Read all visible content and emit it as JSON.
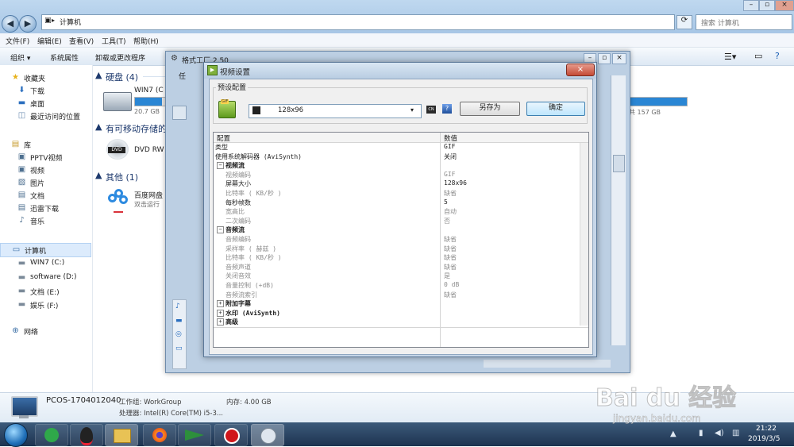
{
  "explorer": {
    "address": "计算机",
    "search_placeholder": "搜索 计算机",
    "menu": [
      "文件(F)",
      "编辑(E)",
      "查看(V)",
      "工具(T)",
      "帮助(H)"
    ],
    "commands": [
      "组织 ▾",
      "系统属性",
      "卸载或更改程序"
    ],
    "nav": {
      "favorites": "收藏夹",
      "downloads": "下载",
      "desktop": "桌面",
      "recent": "最近访问的位置",
      "libraries": "库",
      "pptv": "PPTV视频",
      "videos": "视频",
      "pictures": "图片",
      "documents": "文档",
      "xunlei": "迅雷下载",
      "music": "音乐",
      "computer": "计算机",
      "drive_c": "WIN7 (C:)",
      "drive_d": "software (D:)",
      "drive_e": "文档 (E:)",
      "drive_f": "娱乐 (F:)",
      "network": "网络"
    },
    "groups": {
      "hdd": "硬盘 (4)",
      "removable": "有可移动存储的",
      "other": "其他 (1)"
    },
    "drives": {
      "win7_label": "WIN7 (C",
      "win7_free": "20.7 GB",
      "right_free": "共 157 GB",
      "dvd_label": "DVD RW",
      "baidu_label": "百度网盘",
      "baidu_sub": "双击运行"
    },
    "details": {
      "pc_name": "PCOS-1704012040",
      "workgroup": "工作组: WorkGroup",
      "memory": "内存: 4.00 GB",
      "cpu": "处理器: Intel(R) Core(TM) i5-3..."
    }
  },
  "taskbar": {
    "time": "21:22",
    "date": "2019/3/5"
  },
  "format_window": {
    "title": "格式工厂 2.50",
    "partial_label": "任"
  },
  "dialog": {
    "title": "视频设置",
    "preset_legend": "预设配置",
    "preset_value": "128x96",
    "saveas_label": "另存为",
    "ok_label": "确定",
    "col_config": "配置",
    "col_value": "数值",
    "rows": [
      {
        "c1": "类型",
        "c2": "GIF",
        "level": 0,
        "style": "normal"
      },
      {
        "c1": "使用系统解码器 (AviSynth)",
        "c2": "关闭",
        "level": 0,
        "style": "normal"
      },
      {
        "c1": "视频流",
        "c2": "",
        "level": 0,
        "style": "group-open"
      },
      {
        "c1": "视频编码",
        "c2": "GIF",
        "level": 1,
        "style": "dim"
      },
      {
        "c1": "屏幕大小",
        "c2": "128x96",
        "level": 1,
        "style": "normal"
      },
      {
        "c1": "比特率 ( KB/秒 )",
        "c2": "缺省",
        "level": 1,
        "style": "dim"
      },
      {
        "c1": "每秒帧数",
        "c2": "5",
        "level": 1,
        "style": "normal"
      },
      {
        "c1": "宽高比",
        "c2": "自动",
        "level": 1,
        "style": "dim"
      },
      {
        "c1": "二次编码",
        "c2": "否",
        "level": 1,
        "style": "dim"
      },
      {
        "c1": "音频流",
        "c2": "",
        "level": 0,
        "style": "group-open"
      },
      {
        "c1": "音频编码",
        "c2": "缺省",
        "level": 1,
        "style": "dim"
      },
      {
        "c1": "采样率 ( 赫兹 )",
        "c2": "缺省",
        "level": 1,
        "style": "dim"
      },
      {
        "c1": "比特率 ( KB/秒 )",
        "c2": "缺省",
        "level": 1,
        "style": "dim"
      },
      {
        "c1": "音频声道",
        "c2": "缺省",
        "level": 1,
        "style": "dim"
      },
      {
        "c1": "关闭音效",
        "c2": "是",
        "level": 1,
        "style": "dim"
      },
      {
        "c1": "音量控制 (+dB)",
        "c2": "0 dB",
        "level": 1,
        "style": "dim"
      },
      {
        "c1": "音频流索引",
        "c2": "缺省",
        "level": 1,
        "style": "dim"
      },
      {
        "c1": "附加字幕",
        "c2": "",
        "level": 0,
        "style": "group-closed"
      },
      {
        "c1": "水印 (AviSynth)",
        "c2": "",
        "level": 0,
        "style": "group-closed"
      },
      {
        "c1": "高级",
        "c2": "",
        "level": 0,
        "style": "group-closed"
      }
    ]
  },
  "watermark": {
    "brand": "Bai du 经验",
    "url": "jingyan.baidu.com"
  }
}
